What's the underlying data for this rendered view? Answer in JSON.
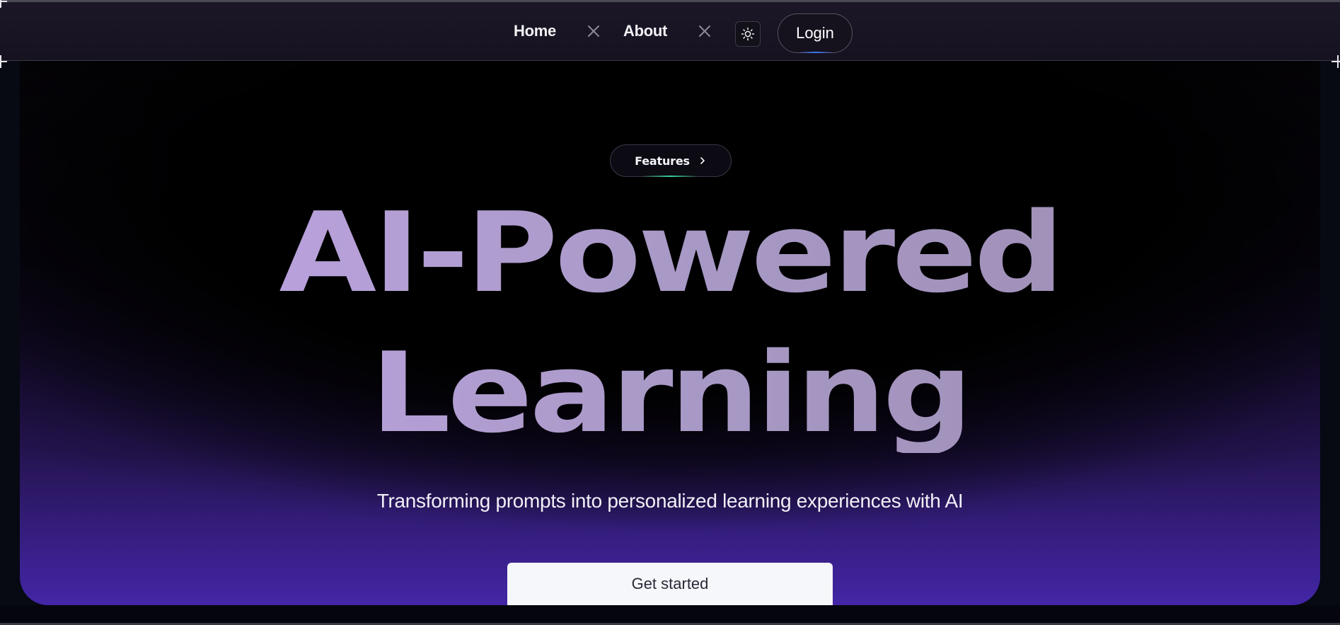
{
  "nav": {
    "links": [
      {
        "label": "Home"
      },
      {
        "label": "About"
      }
    ],
    "separator_icon": "close-x-icon",
    "theme_toggle_icon": "sun-icon",
    "login_label": "Login"
  },
  "hero": {
    "pill": {
      "label": "Features",
      "icon": "chevron-right-icon"
    },
    "headline_line1": "AI-Powered",
    "headline_line2": "Learning",
    "subtitle": "Transforming prompts into personalized learning experiences with AI",
    "cta_label": "Get started"
  },
  "colors": {
    "background": "#070913",
    "hero_glow": "#4326a6",
    "headline_start": "#c8a9ee",
    "headline_end": "#9a8aae",
    "login_accent": "#3c7bff",
    "pill_accent": "#35d39b",
    "cta_background": "#f6f7fa"
  }
}
